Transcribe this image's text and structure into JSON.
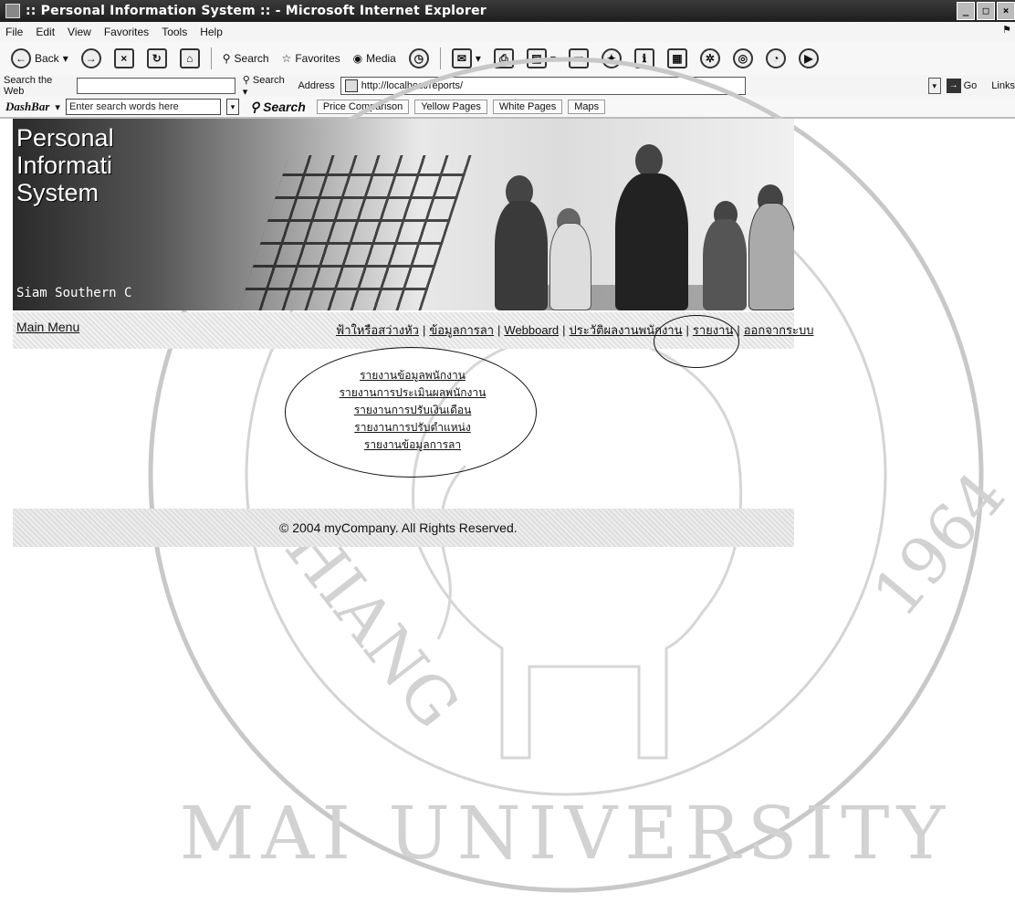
{
  "window": {
    "title": ":: Personal Information System :: - Microsoft Internet Explorer",
    "controls": [
      "_",
      "□",
      "×"
    ]
  },
  "menu": {
    "items": [
      "File",
      "Edit",
      "View",
      "Favorites",
      "Tools",
      "Help"
    ]
  },
  "toolbar": {
    "back_label": "Back",
    "search_label": "Search",
    "favorites_label": "Favorites",
    "media_label": "Media"
  },
  "address_bar": {
    "search_web_label": "Search the Web",
    "search_button": "Search",
    "address_label": "Address",
    "url": "http://localhost/reports/",
    "go_label": "Go",
    "links_label": "Links"
  },
  "dashbar": {
    "logo": "DashBar",
    "search_placeholder": "Enter search words here",
    "search_button": "Search",
    "links": [
      "Price Comparison",
      "Yellow Pages",
      "White Pages",
      "Maps"
    ]
  },
  "banner": {
    "brand_lines": [
      "Personal",
      "Informati",
      "System"
    ],
    "subtitle": "Siam Southern C"
  },
  "nav": {
    "main_menu": "Main Menu",
    "links": [
      "ฟ้าใหรือสว่างหัว",
      "ข้อมูลการลา",
      "Webboard",
      "ประวัติผลงานพนักงาน",
      "รายงาน",
      "ออกจากระบบ"
    ]
  },
  "reports": {
    "items": [
      "รายงานข้อมูลพนักงาน",
      "รายงานการประเมินผลพนักงาน",
      "รายงานการปรับเงินเดือน",
      "รายงานการปรับตำแหน่ง",
      "รายงานข้อมูลการลา"
    ]
  },
  "footer": {
    "copyright": "© 2004 myCompany. All Rights Reserved."
  },
  "watermark": {
    "text_lines": [
      "CHIANG MAI UNIVERSITY",
      "1964"
    ]
  }
}
